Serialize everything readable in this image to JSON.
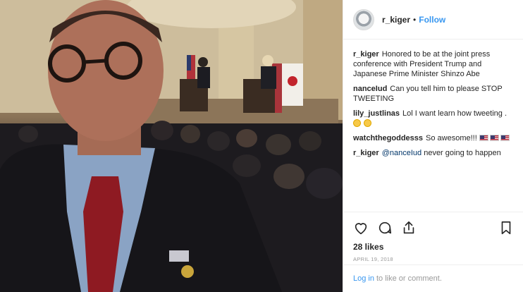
{
  "post": {
    "username": "r_kiger",
    "separator": "•",
    "follow_label": "Follow",
    "likes": "28 likes",
    "date": "APRIL 19, 2018"
  },
  "comments": [
    {
      "user": "r_kiger",
      "text": "Honored to be at the joint press conference with President Trump and Japanese Prime Minister Shinzo Abe"
    },
    {
      "user": "nanceIud",
      "text": "Can you tell him to please STOP TWEETING"
    },
    {
      "user": "lily_justlinas",
      "text": "Lol I want learn how tweeting ."
    },
    {
      "user": "watchthegoddesss",
      "text": "So awesome!!!"
    },
    {
      "user": "r_kiger",
      "mention": "@nanceIud",
      "text": "never going to happen"
    }
  ],
  "login": {
    "link_label": "Log in",
    "suffix": "to like or comment."
  },
  "icons": {
    "like": "heart-icon",
    "comment": "comment-icon",
    "share": "share-icon",
    "save": "bookmark-icon"
  },
  "colors": {
    "accent": "#3897f0",
    "text": "#262626",
    "muted": "#999999",
    "border": "#efefef"
  }
}
